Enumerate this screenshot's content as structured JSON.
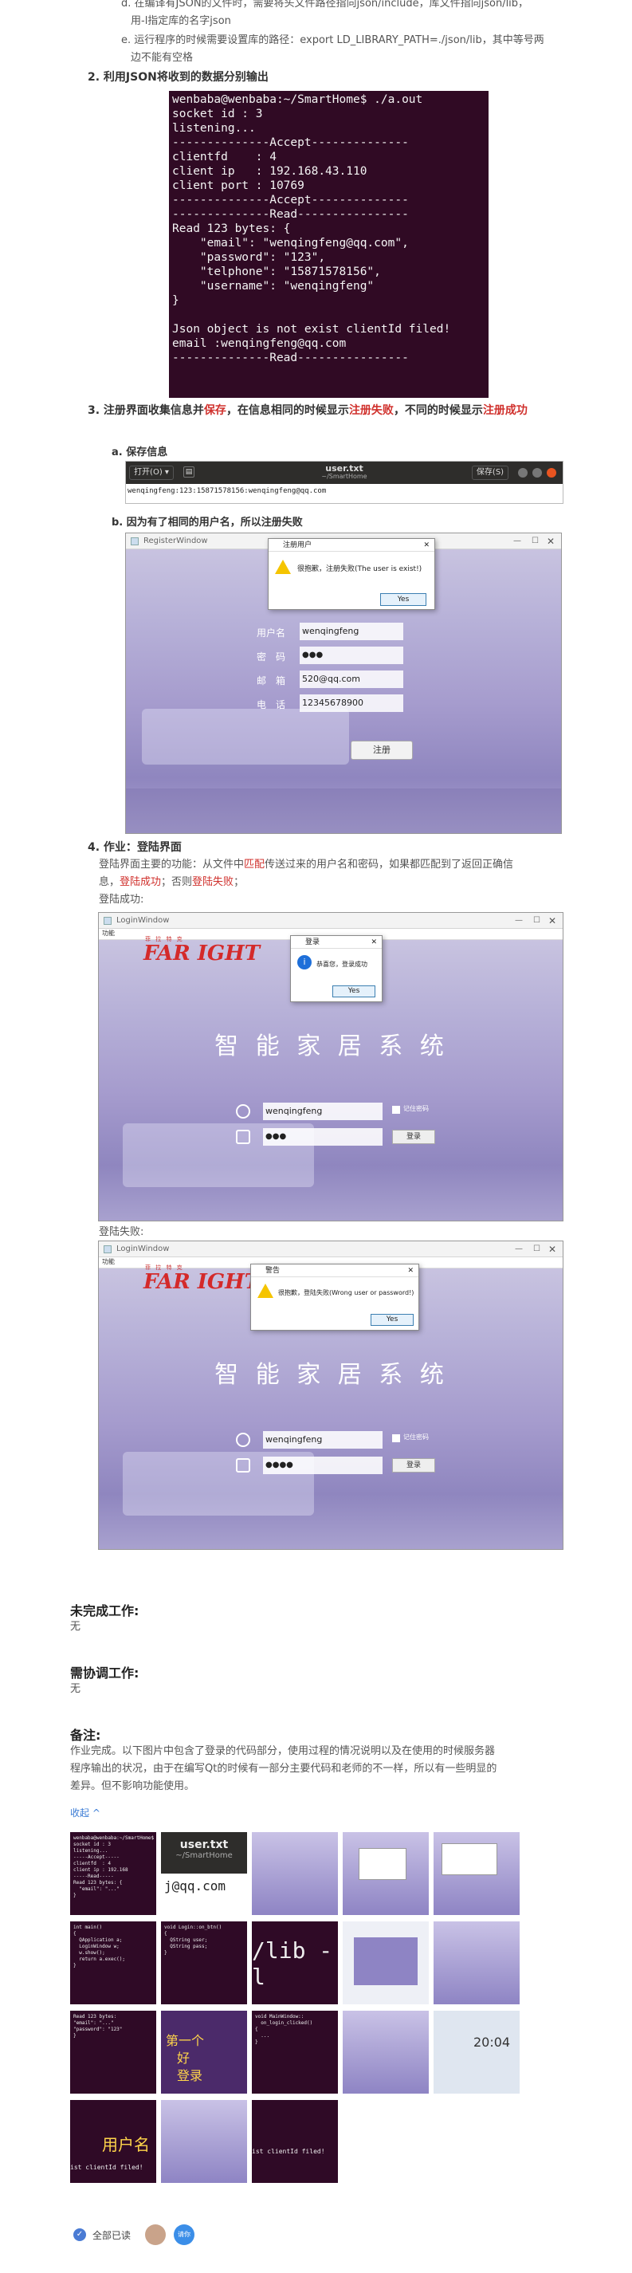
{
  "intro": {
    "item_d": "d. 在编译有JSON的文件时，需要将头文件路径指向json/include，库文件指向json/lib，",
    "item_d2": "用-l指定库的名字json",
    "item_e": "e. 运行程序的时候需要设置库的路径：export LD_LIBRARY_PATH=./json/lib，其中等号两",
    "item_e2": "边不能有空格"
  },
  "step2": {
    "heading": "2. 利用JSON将收到的数据分别输出",
    "terminal_lines": [
      "wenbaba@wenbaba:~/SmartHome$ ./a.out",
      "socket id : 3",
      "listening...",
      "--------------Accept--------------",
      "clientfd    : 4",
      "client ip   : 192.168.43.110",
      "client port : 10769",
      "--------------Accept--------------",
      "--------------Read----------------",
      "Read 123 bytes: {",
      "    \"email\": \"wenqingfeng@qq.com\",",
      "    \"password\": \"123\",",
      "    \"telphone\": \"15871578156\",",
      "    \"username\": \"wenqingfeng\"",
      "}",
      "",
      "Json object is not exist clientId filed!",
      "email :wenqingfeng@qq.com",
      "--------------Read----------------"
    ]
  },
  "step3": {
    "heading_pre": "3. 注册界面收集信息并",
    "heading_save": "保存",
    "heading_mid": "，在信息相同的时候显示",
    "heading_fail": "注册失败",
    "heading_mid2": "，不同的时候显示",
    "heading_ok": "注册成功",
    "sub_a": "a. 保存信息",
    "editor": {
      "open_btn": "打开(O) ▾",
      "title": "user.txt",
      "subtitle": "~/SmartHome",
      "save_btn": "保存(S)",
      "content": "wenqingfeng:123:15871578156:wenqingfeng@qq.com"
    },
    "sub_b": "b. 因为有了相同的用户名，所以注册失败",
    "register": {
      "window_title": "RegisterWindow",
      "dialog_title": "注册用户",
      "dialog_msg": "很抱歉，注册失败(The user is exist!)",
      "dialog_btn": "Yes",
      "labels": [
        "用户名",
        "密　码",
        "邮　箱",
        "电　话"
      ],
      "values": [
        "wenqingfeng",
        "●●●",
        "520@qq.com",
        "12345678900"
      ],
      "submit": "注册"
    }
  },
  "step4": {
    "heading_pre": "4. 作业：",
    "heading_main": "登陆界面",
    "desc1_pre": "登陆界面主要的功能：从文件中",
    "desc1_match": "匹配",
    "desc1_post": "传送过来的用户名和密码，如果都匹配到了返回正确信",
    "desc2_pre": "息，",
    "desc2_ok": "登陆成功",
    "desc2_mid": "；否则",
    "desc2_fail": "登陆失败",
    "desc2_end": "；",
    "success_label": "登陆成功:",
    "fail_label": "登陆失败:",
    "login_success": {
      "window_title": "LoginWindow",
      "menu": "功能",
      "logo": "FAR  IGHT",
      "logo_top": "菲 拉 特 克",
      "system_title": "智 能 家 居 系 统",
      "dialog_title": "登录",
      "dialog_msg": "恭喜您，登录成功",
      "dialog_btn": "Yes",
      "username": "wenqingfeng",
      "password": "●●●",
      "remember": "记住密码",
      "login_btn": "登录"
    },
    "login_fail": {
      "window_title": "LoginWindow",
      "menu": "功能",
      "logo": "FAR  IGHT",
      "logo_top": "菲 拉 特 克",
      "system_title": "智 能 家 居 系 统",
      "dialog_title": "警告",
      "dialog_msg": "很抱歉，登陆失败(Wrong user or password!)",
      "dialog_btn": "Yes",
      "username": "wenqingfeng",
      "password": "●●●●",
      "remember": "记住密码",
      "login_btn": "登录"
    }
  },
  "unfinished": {
    "heading": "未完成工作:",
    "value": "无"
  },
  "coordination": {
    "heading": "需协调工作:",
    "value": "无"
  },
  "notes": {
    "heading": "备注:",
    "text1": "作业完成。以下图片中包含了登录的代码部分，使用过程的情况说明以及在使用的时候服务器",
    "text2": "程序输出的状况，由于在编写Qt的时候有一部分主要代码和老师的不一样，所以有一些明显的",
    "text3": "差异。但不影响功能使用。",
    "collapse": "收起 ^"
  },
  "thumbs": {
    "t2_title": "user.txt",
    "t2_sub": "~/SmartHome",
    "t2_text": "j@qq.com",
    "t7_text": "/lib -l",
    "t10_text": "第一个",
    "t10_text2": "好",
    "t10_text3": "登录",
    "t14_text": "20:04",
    "t16_text": "用户名",
    "t16_text2": "ist clientId filed!",
    "t17_text": "ist clientId filed!"
  },
  "footer": {
    "read_status": "全部已读",
    "badge_text": "请你"
  }
}
